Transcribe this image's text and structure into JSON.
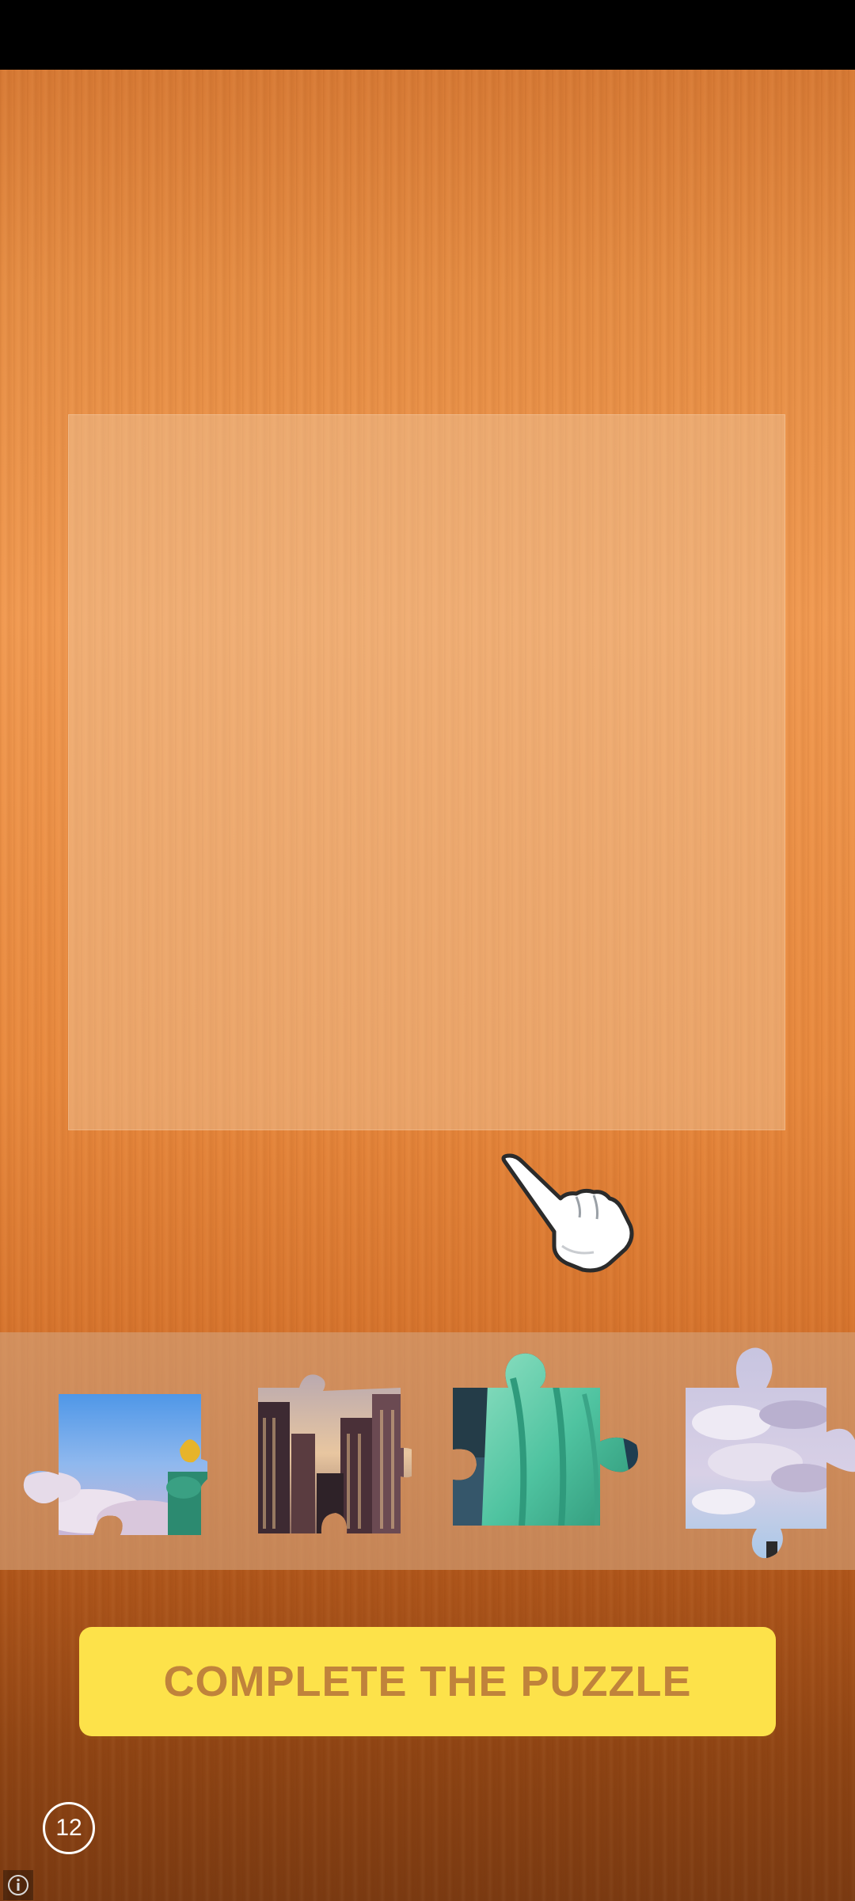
{
  "game": {
    "cta_label": "COMPLETE THE PUZZLE",
    "remaining_count": "12"
  },
  "tray": {
    "pieces": [
      {
        "name": "sky-statue-torch-piece"
      },
      {
        "name": "city-skyline-piece"
      },
      {
        "name": "statue-robe-piece"
      },
      {
        "name": "cloudy-sky-piece"
      }
    ]
  },
  "icons": {
    "hand": "hand-pointer-icon",
    "info": "info-icon"
  },
  "colors": {
    "cta_background": "#fde24a",
    "cta_text": "#c0833b"
  }
}
